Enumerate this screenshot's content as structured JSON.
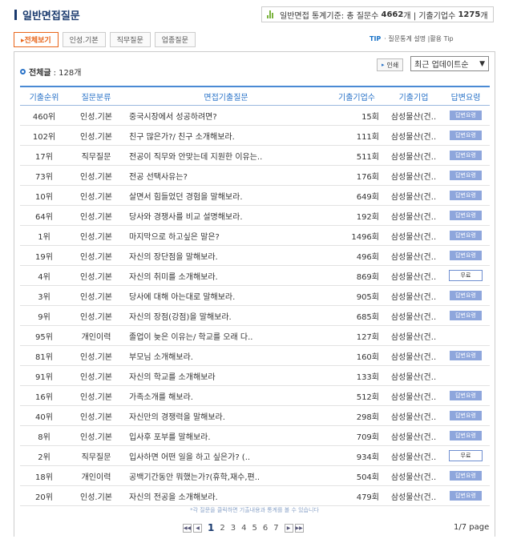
{
  "page_title": "일반면접질문",
  "stats": {
    "prefix": "일반면접 통계기준: 총 질문수",
    "question_count": "4662",
    "sep": "개 | 기출기업수",
    "company_count": "1275",
    "suffix": "개"
  },
  "tabs": [
    "▸전체보기",
    "인성.기본",
    "직무질문",
    "업종질문"
  ],
  "tip": {
    "label": "TIP",
    "text": "· 질문통계 설명 |활용 Tip"
  },
  "total": {
    "label": "전체글",
    "count": ": 128개"
  },
  "print_label": "인쇄",
  "sort_value": "최근 업데이트순",
  "columns": [
    "기출순위",
    "질문분류",
    "면접기출질문",
    "기출기업수",
    "기출기업",
    "답변요령"
  ],
  "rows": [
    {
      "rank": "460위",
      "cat": "인성.기본",
      "q": "중국시장에서 성공하려면?",
      "cnt": "15회",
      "co": "삼성물산(건..",
      "badge": "답변요령",
      "type": "answer"
    },
    {
      "rank": "102위",
      "cat": "인성.기본",
      "q": "친구 많은가?/ 친구 소개해보라.",
      "cnt": "111회",
      "co": "삼성물산(건..",
      "badge": "답변요령",
      "type": "answer"
    },
    {
      "rank": "17위",
      "cat": "직무질문",
      "q": "전공이 직무와 안맞는데 지원한 이유는..",
      "cnt": "511회",
      "co": "삼성물산(건..",
      "badge": "답변요령",
      "type": "answer"
    },
    {
      "rank": "73위",
      "cat": "인성.기본",
      "q": "전공 선택사유는?",
      "cnt": "176회",
      "co": "삼성물산(건..",
      "badge": "답변요령",
      "type": "answer"
    },
    {
      "rank": "10위",
      "cat": "인성.기본",
      "q": "살면서 힘들었던 경험을 말해보라.",
      "cnt": "649회",
      "co": "삼성물산(건..",
      "badge": "답변요령",
      "type": "answer"
    },
    {
      "rank": "64위",
      "cat": "인성.기본",
      "q": "당사와 경쟁사를 비교 설명해보라.",
      "cnt": "192회",
      "co": "삼성물산(건..",
      "badge": "답변요령",
      "type": "answer"
    },
    {
      "rank": "1위",
      "cat": "인성.기본",
      "q": "마지막으로 하고싶은 말은?",
      "cnt": "1496회",
      "co": "삼성물산(건..",
      "badge": "답변요령",
      "type": "answer"
    },
    {
      "rank": "19위",
      "cat": "인성.기본",
      "q": "자신의 장단점을 말해보라.",
      "cnt": "496회",
      "co": "삼성물산(건..",
      "badge": "답변요령",
      "type": "answer"
    },
    {
      "rank": "4위",
      "cat": "인성.기본",
      "q": "자신의 취미를 소개해보라.",
      "cnt": "869회",
      "co": "삼성물산(건..",
      "badge": "무료",
      "type": "free"
    },
    {
      "rank": "3위",
      "cat": "인성.기본",
      "q": "당사에 대해 아는대로 말해보라.",
      "cnt": "905회",
      "co": "삼성물산(건..",
      "badge": "답변요령",
      "type": "answer"
    },
    {
      "rank": "9위",
      "cat": "인성.기본",
      "q": "자신의 장점(강점)을 말해보라.",
      "cnt": "685회",
      "co": "삼성물산(건..",
      "badge": "답변요령",
      "type": "answer"
    },
    {
      "rank": "95위",
      "cat": "개인이력",
      "q": "졸업이 늦은 이유는/ 학교를 오래 다..",
      "cnt": "127회",
      "co": "삼성물산(건..",
      "badge": "",
      "type": "none"
    },
    {
      "rank": "81위",
      "cat": "인성.기본",
      "q": "부모님 소개해보라.",
      "cnt": "160회",
      "co": "삼성물산(건..",
      "badge": "답변요령",
      "type": "answer"
    },
    {
      "rank": "91위",
      "cat": "인성.기본",
      "q": "자신의 학교를 소개해보라",
      "cnt": "133회",
      "co": "삼성물산(건..",
      "badge": "",
      "type": "none"
    },
    {
      "rank": "16위",
      "cat": "인성.기본",
      "q": "가족소개를 해보라.",
      "cnt": "512회",
      "co": "삼성물산(건..",
      "badge": "답변요령",
      "type": "answer"
    },
    {
      "rank": "40위",
      "cat": "인성.기본",
      "q": "자신만의 경쟁력을 말해보라.",
      "cnt": "298회",
      "co": "삼성물산(건..",
      "badge": "답변요령",
      "type": "answer"
    },
    {
      "rank": "8위",
      "cat": "인성.기본",
      "q": "입사후 포부를 말해보라.",
      "cnt": "709회",
      "co": "삼성물산(건..",
      "badge": "답변요령",
      "type": "answer"
    },
    {
      "rank": "2위",
      "cat": "직무질문",
      "q": "입사하면 어떤 일을 하고 싶은가? (..",
      "cnt": "934회",
      "co": "삼성물산(건..",
      "badge": "무료",
      "type": "free"
    },
    {
      "rank": "18위",
      "cat": "개인이력",
      "q": "공백기간동안 뭐했는가?(휴학,재수,편..",
      "cnt": "504회",
      "co": "삼성물산(건..",
      "badge": "답변요령",
      "type": "answer"
    },
    {
      "rank": "20위",
      "cat": "인성.기본",
      "q": "자신의 전공을 소개해보라.",
      "cnt": "479회",
      "co": "삼성물산(건..",
      "badge": "답변요령",
      "type": "answer"
    }
  ],
  "footnote": "*각 질문을 클릭하면 기출내용과 통계를 볼 수 있습니다",
  "pagination": {
    "first": "◀◀",
    "prev": "◀",
    "next": "▶",
    "last": "▶▶",
    "pages": [
      "1",
      "2",
      "3",
      "4",
      "5",
      "6",
      "7"
    ],
    "current": "1",
    "info": "1/7 page"
  },
  "colors": {
    "accent": "#2a73c8",
    "tab_active": "#e8651a",
    "badge": "#8ea6dc"
  }
}
